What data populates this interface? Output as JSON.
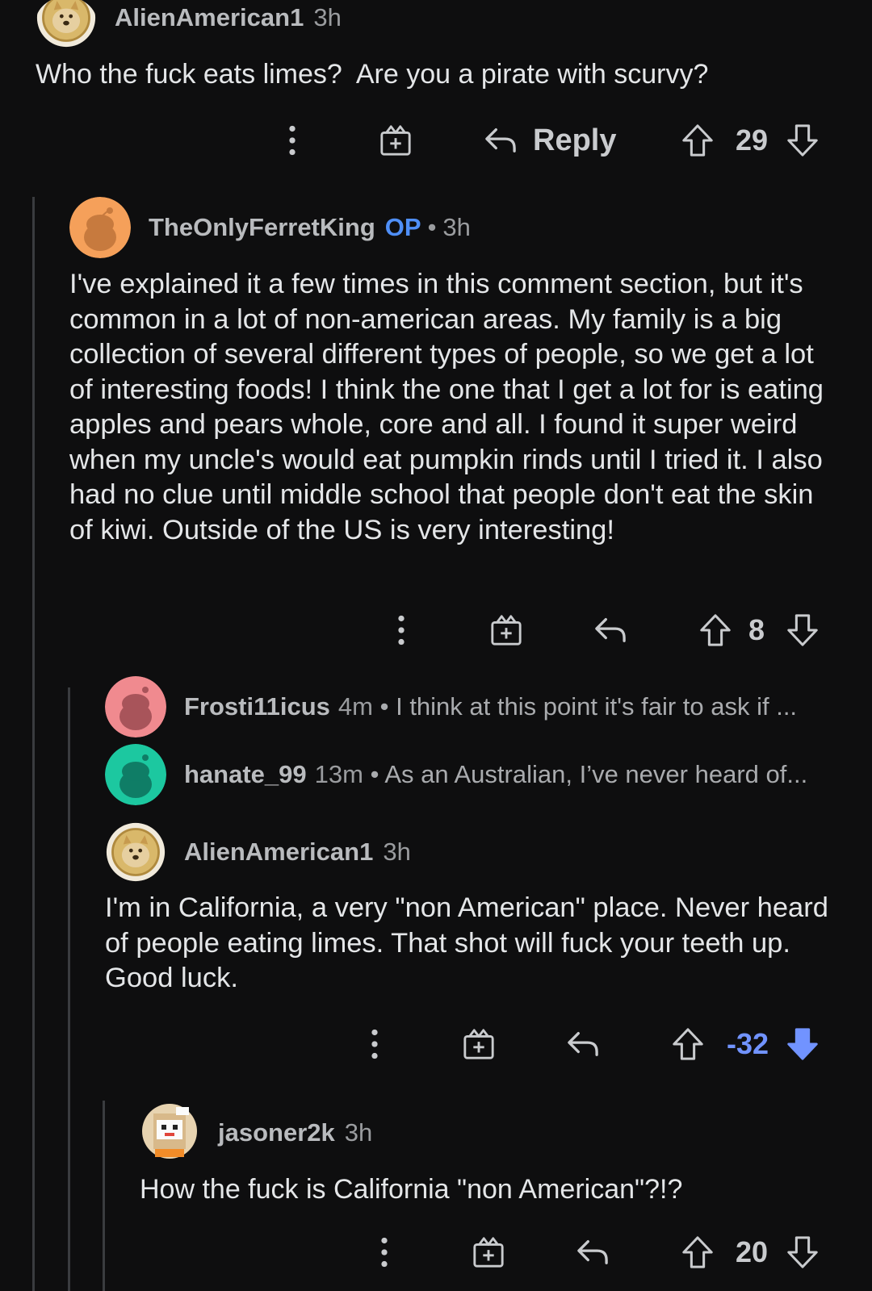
{
  "comments": [
    {
      "username": "AlienAmerican1",
      "time": "3h",
      "body": "Who the fuck eats limes?  Are you a pirate with scurvy?",
      "score": "29",
      "reply_label": "Reply"
    },
    {
      "username": "TheOnlyFerretKing",
      "op_badge": "OP",
      "dot": "•",
      "time": "3h",
      "body": "I've explained it a few times in this comment section, but it's common in a lot of non-american areas. My family is a big collection of several different types of people, so we get a lot of interesting foods! I think the one that I get a lot for is eating apples and pears whole, core and all. I found it super weird when my uncle's would eat pumpkin rinds until I tried it. I also had no clue until middle school that people don't eat the skin of kiwi. Outside of the US is very interesting!",
      "score": "8"
    },
    {
      "username": "AlienAmerican1",
      "time": "3h",
      "body": "I'm in California, a very \"non American\" place.  Never heard of people eating limes.  That shot will fuck your teeth up.  Good luck.",
      "score": "-32"
    },
    {
      "username": "jasoner2k",
      "time": "3h",
      "body": "How the fuck is California \"non American\"?!?",
      "score": "20"
    }
  ],
  "collapsed_replies": [
    {
      "username": "Frosti11icus",
      "time": "4m",
      "snippet": "• I think at this point it's fair to ask if ...",
      "avatar_color": "#f08a8f"
    },
    {
      "username": "hanate_99",
      "time": "13m",
      "snippet": "• As an Australian, I’ve never heard of...",
      "avatar_color": "#1cc8a0"
    }
  ],
  "colors": {
    "background": "#0e0e0f",
    "op_blue": "#4f8ff7",
    "downvoted_blue": "#7193ff",
    "thread_line": "#3a3c3f"
  },
  "icons": [
    "more-options-icon",
    "award-gift-icon",
    "reply-arrow-icon",
    "upvote-arrow-icon",
    "downvote-arrow-icon",
    "doge-avatar",
    "snoo-avatar",
    "pixel-snoo-avatar"
  ]
}
